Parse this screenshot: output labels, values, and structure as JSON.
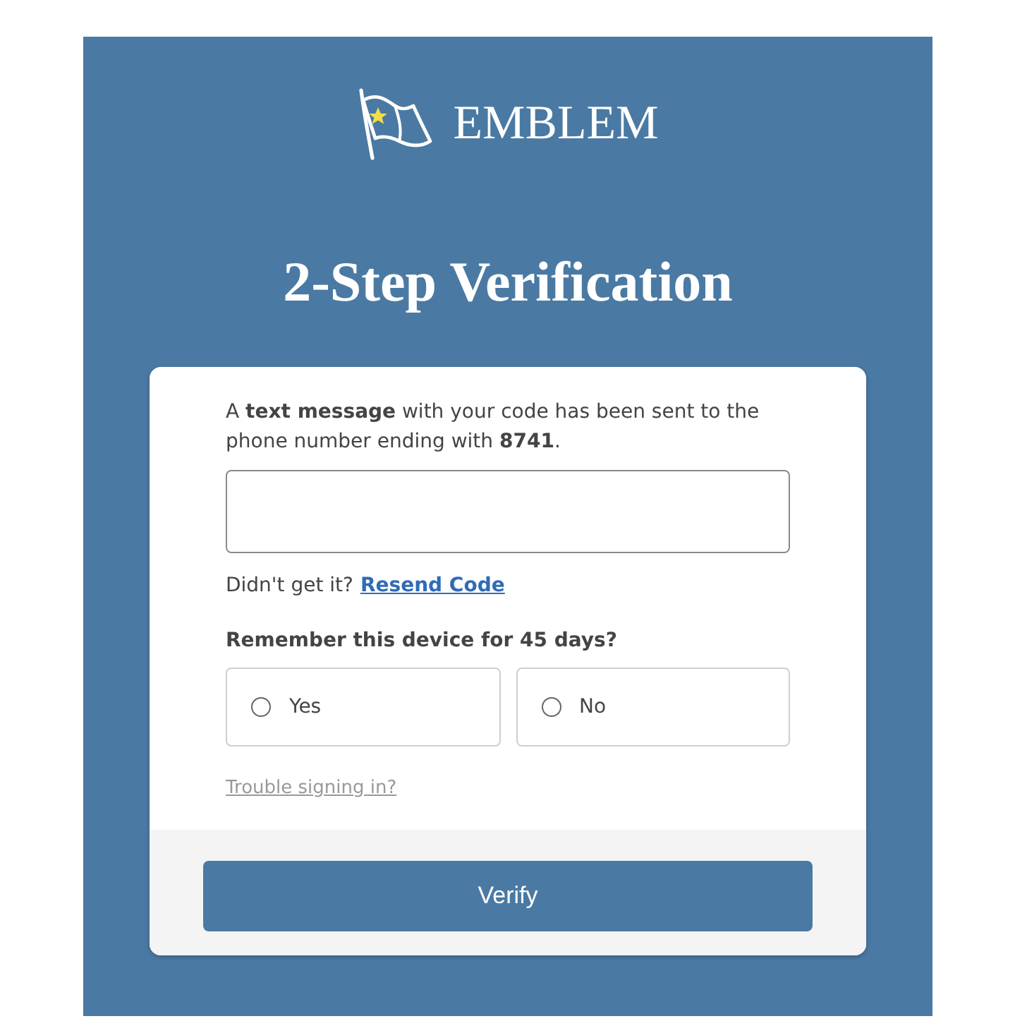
{
  "logo": {
    "wordmark": "EMBLEM"
  },
  "title": "2-Step Verification",
  "card": {
    "message": "A **text message** with your code has been sent to the phone number ending with **8741**.",
    "resend": {
      "prompt": "Didn't get it?",
      "link": "Resend Code"
    },
    "remember": {
      "question": "Remember this device for 45 days?",
      "options": [
        {
          "label": "Yes",
          "selected": false
        },
        {
          "label": "No",
          "selected": false
        }
      ]
    },
    "help_link": "Trouble signing in?",
    "submit_button": "Verify"
  }
}
